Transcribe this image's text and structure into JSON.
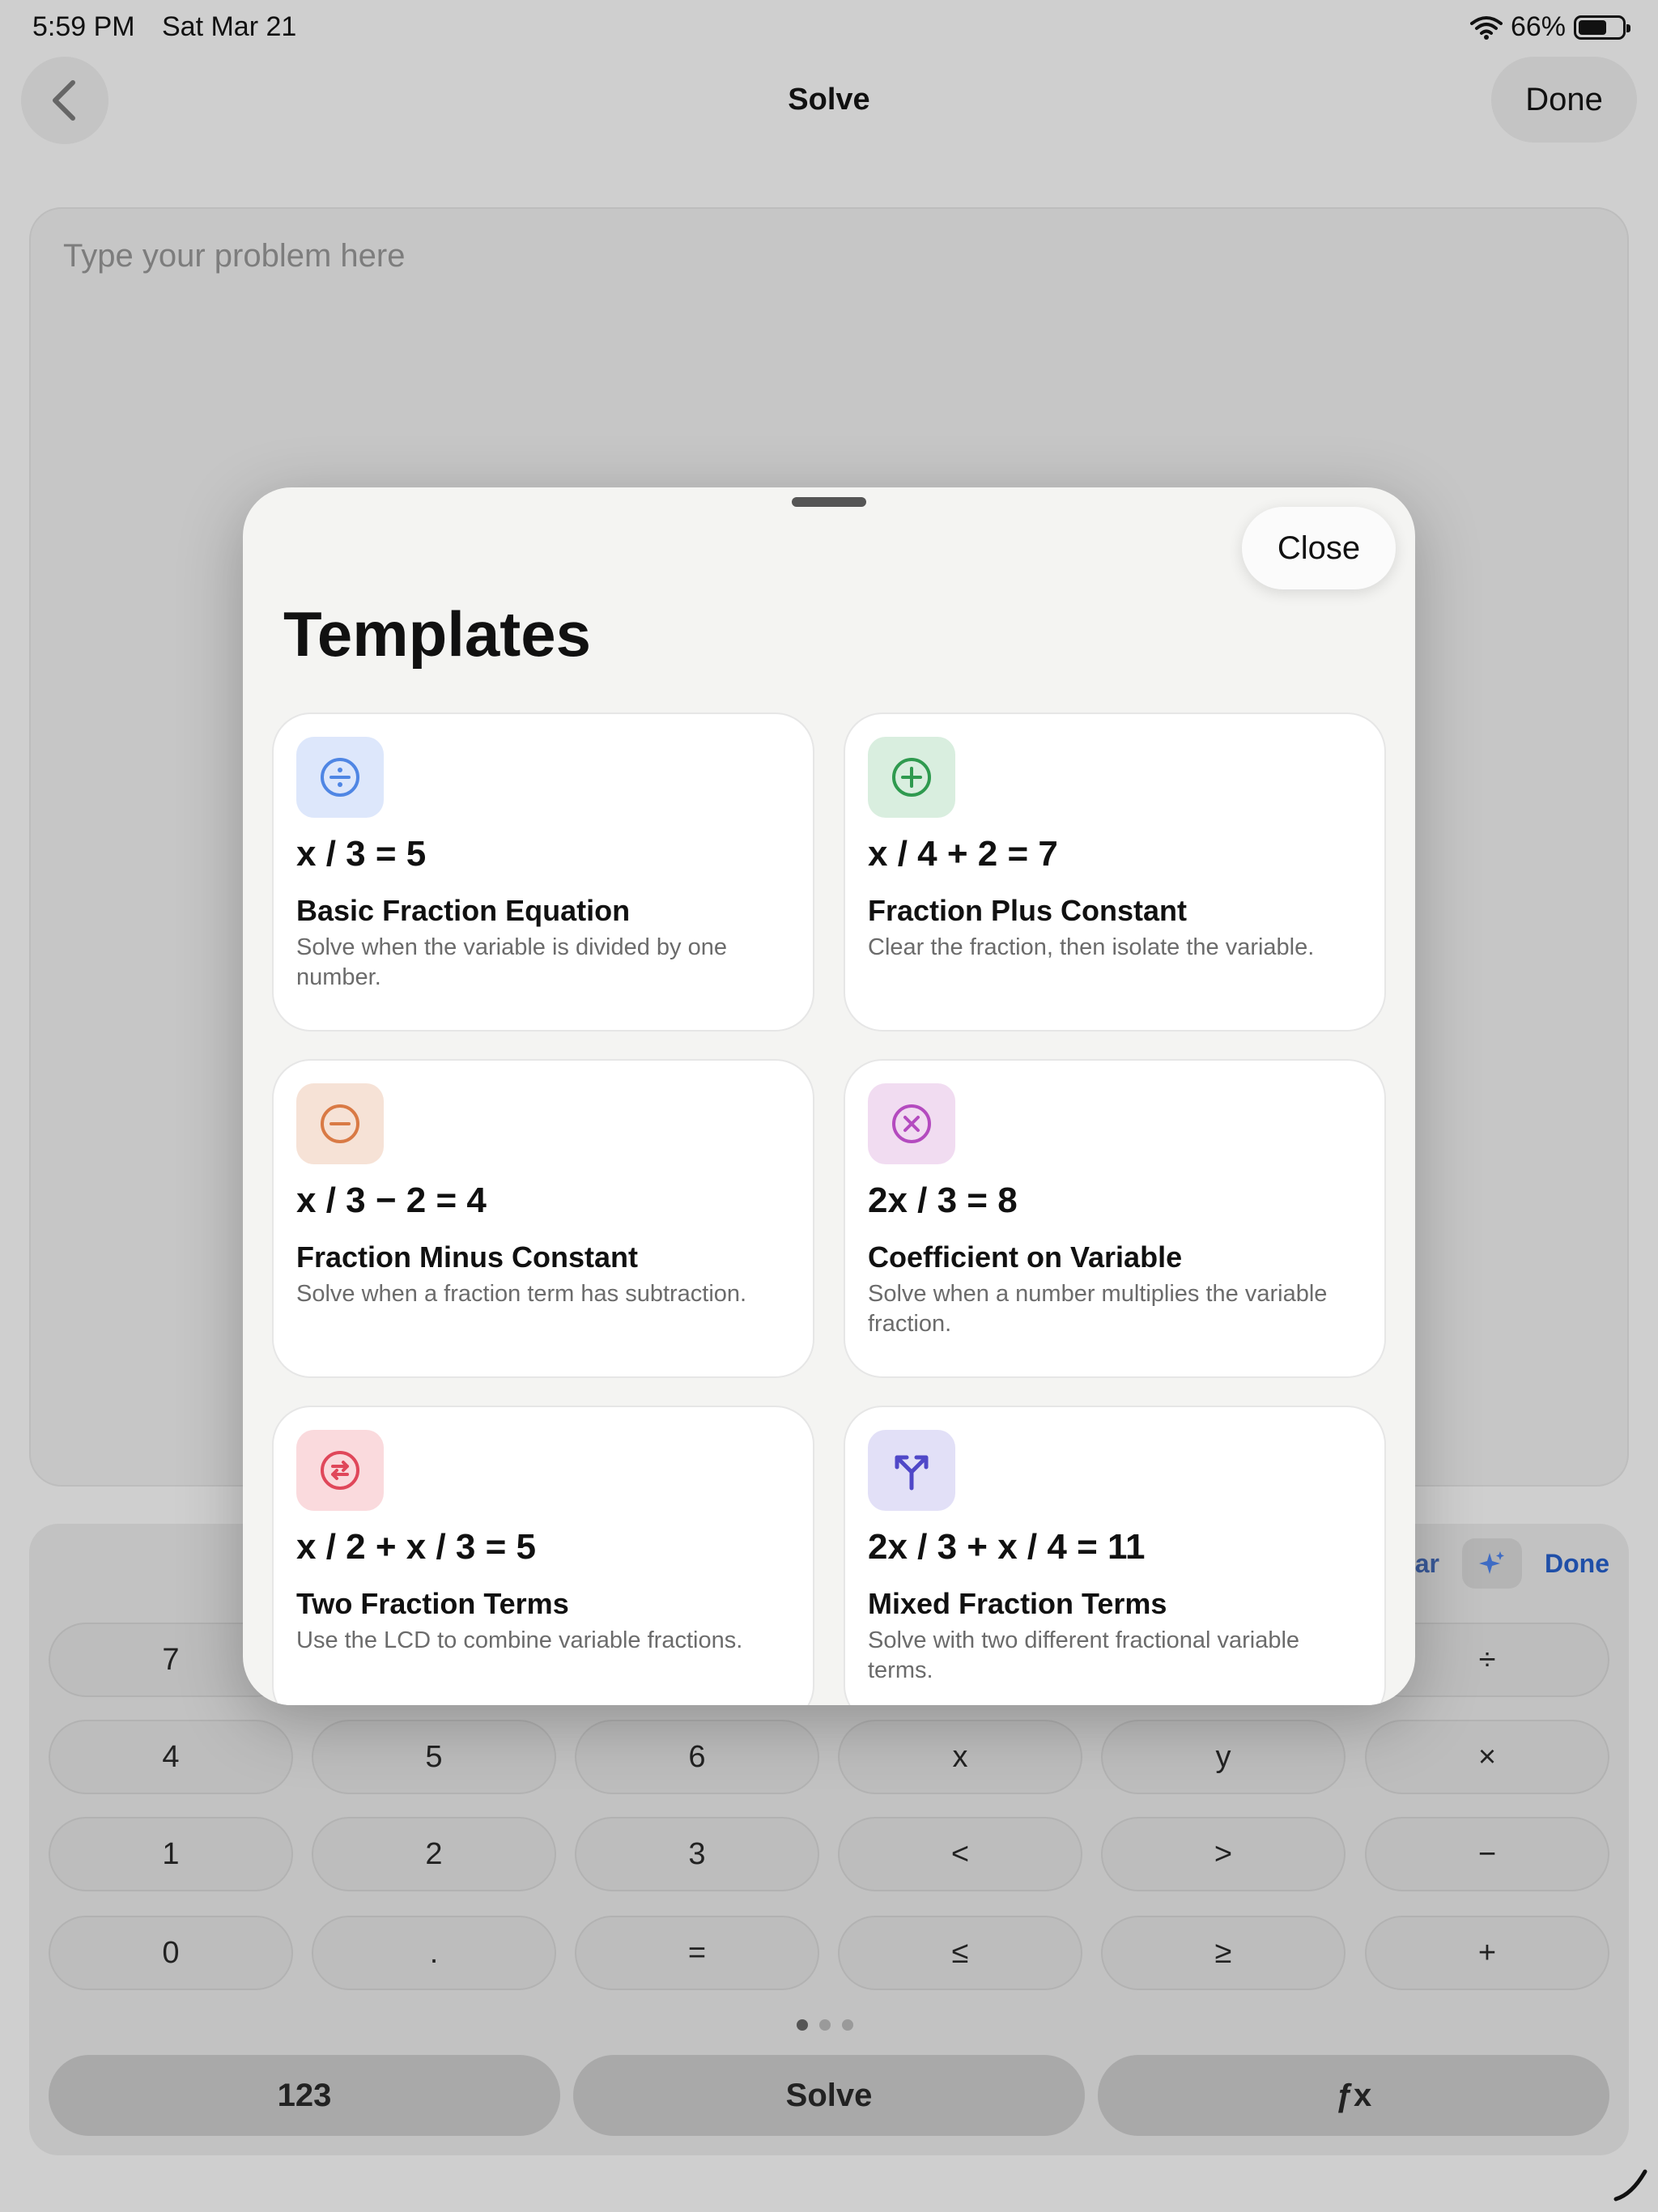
{
  "status": {
    "time": "5:59 PM",
    "date": "Sat Mar 21",
    "battery": "66%"
  },
  "nav": {
    "title": "Solve",
    "done": "Done"
  },
  "problem": {
    "placeholder": "Type your problem here"
  },
  "keyboard": {
    "toolbar": {
      "clear_partial": "ar",
      "done": "Done"
    },
    "rows": [
      [
        "7",
        "",
        "",
        "",
        "",
        "÷"
      ],
      [
        "4",
        "5",
        "6",
        "x",
        "y",
        "×"
      ],
      [
        "1",
        "2",
        "3",
        "<",
        ">",
        "−"
      ],
      [
        "0",
        ".",
        "=",
        "≤",
        "≥",
        "+"
      ]
    ],
    "page_count": 3,
    "active_page": 1,
    "bottom": [
      "123",
      "Solve",
      "ƒx"
    ]
  },
  "sheet": {
    "close": "Close",
    "title": "Templates",
    "cards": [
      {
        "equation": "x / 3 = 5",
        "title": "Basic Fraction Equation",
        "desc": "Solve when the variable is divided by one number.",
        "icon": "divide-circle-icon",
        "icon_bg": "#dde7fb",
        "icon_color": "#4f86e4"
      },
      {
        "equation": "x / 4 + 2 = 7",
        "title": "Fraction Plus Constant",
        "desc": "Clear the fraction, then isolate the variable.",
        "icon": "plus-circle-icon",
        "icon_bg": "#d9eedf",
        "icon_color": "#2f9a4f"
      },
      {
        "equation": "x / 3 − 2 = 4",
        "title": "Fraction Minus Constant",
        "desc": "Solve when a fraction term has subtraction.",
        "icon": "minus-circle-icon",
        "icon_bg": "#f6e2d6",
        "icon_color": "#d97a45"
      },
      {
        "equation": "2x / 3 = 8",
        "title": "Coefficient on Variable",
        "desc": "Solve when a number multiplies the variable fraction.",
        "icon": "multiply-circle-icon",
        "icon_bg": "#f1dcf1",
        "icon_color": "#b44bbf"
      },
      {
        "equation": "x / 2 + x / 3 = 5",
        "title": "Two Fraction Terms",
        "desc": "Use the LCD to combine variable fractions.",
        "icon": "swap-circle-icon",
        "icon_bg": "#fadadd",
        "icon_color": "#e0475a"
      },
      {
        "equation": "2x / 3 + x / 4 = 11",
        "title": "Mixed Fraction Terms",
        "desc": "Solve with two different fractional variable terms.",
        "icon": "merge-arrows-icon",
        "icon_bg": "#e2e0f7",
        "icon_color": "#5048c8"
      }
    ]
  }
}
